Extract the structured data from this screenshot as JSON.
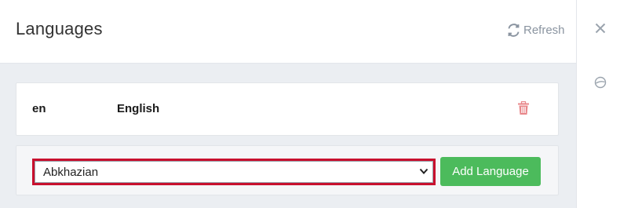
{
  "modal": {
    "title": "Languages",
    "refresh_label": "Refresh"
  },
  "languages": [
    {
      "code": "en",
      "name": "English"
    }
  ],
  "add_language": {
    "selected_option": "Abkhazian",
    "button_label": "Add Language"
  },
  "colors": {
    "add_button": "#4cbb5c",
    "trash_icon": "#e8878a",
    "highlight_border": "#c8102e",
    "body_background": "#ebeef2"
  },
  "icons": {
    "refresh": "refresh-icon",
    "trash": "trash-icon",
    "close": "close-icon",
    "side": "circle-slash-icon"
  }
}
